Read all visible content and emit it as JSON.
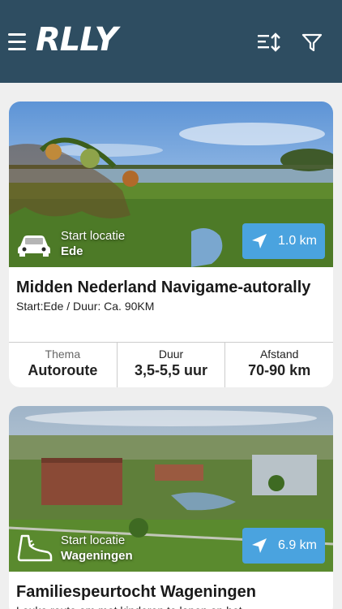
{
  "app": {
    "logo": "RLLY"
  },
  "header": {
    "menu_icon": "hamburger-menu-icon",
    "sort_icon": "sort-icon",
    "filter_icon": "filter-funnel-icon",
    "background": "#2e4d61"
  },
  "colors": {
    "accent": "#4aa3df"
  },
  "routes": [
    {
      "start_label": "Start locatie",
      "start_city": "Ede",
      "transport_icon": "car-icon",
      "distance": "1.0 km",
      "title": "Midden Nederland Navigame-autorally",
      "subtitle": "Start:Ede / Duur: Ca. 90KM",
      "stats": [
        {
          "label": "Thema",
          "value": "Autoroute"
        },
        {
          "label": "Duur",
          "value": "3,5-5,5 uur"
        },
        {
          "label": "Afstand",
          "value": "70-90 km"
        }
      ]
    },
    {
      "start_label": "Start locatie",
      "start_city": "Wageningen",
      "transport_icon": "walking-shoe-icon",
      "distance": "6.9 km",
      "title": "Familiespeurtocht Wageningen",
      "subtitle": "Leuke route om met kinderen te lopen op het"
    }
  ]
}
